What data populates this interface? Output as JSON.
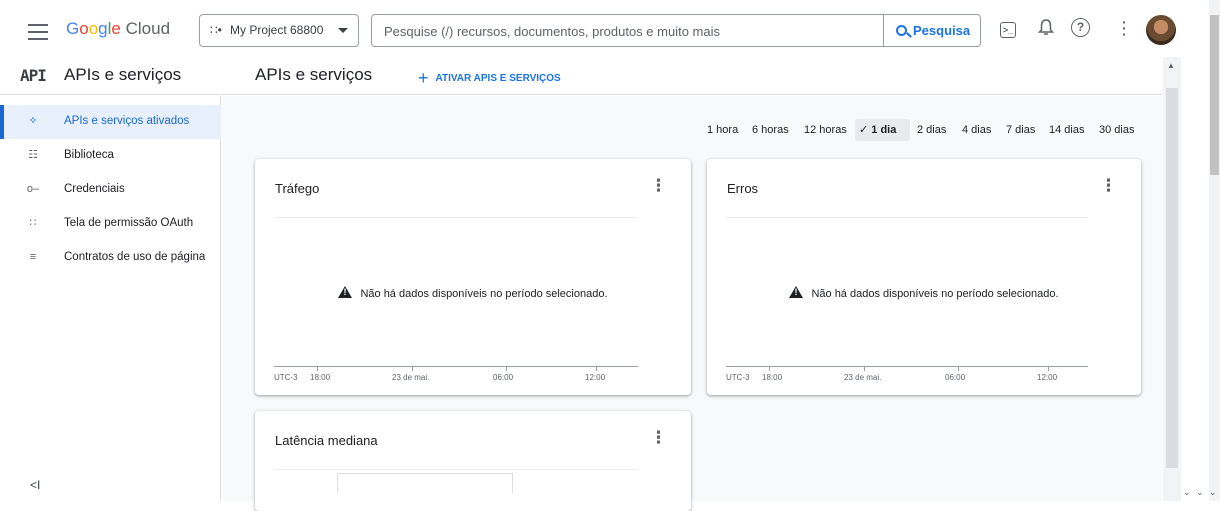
{
  "header": {
    "logo": {
      "g1": "G",
      "g2": "o",
      "g3": "o",
      "g4": "g",
      "g5": "l",
      "g6": "e",
      "cloud": "Cloud"
    },
    "project": "My Project 68800",
    "search_placeholder": "Pesquise (/) recursos, documentos, produtos e muito mais",
    "search_button": "Pesquisa"
  },
  "sidebar": {
    "product_icon_text": "API",
    "title": "APIs e serviços",
    "items": [
      {
        "label": "APIs e serviços ativados",
        "icon": "api-nodes-icon"
      },
      {
        "label": "Biblioteca",
        "icon": "library-icon"
      },
      {
        "label": "Credenciais",
        "icon": "key-icon"
      },
      {
        "label": "Tela de permissão OAuth",
        "icon": "oauth-consent-icon"
      },
      {
        "label": "Contratos de uso de página",
        "icon": "page-usage-icon"
      }
    ],
    "collapse_glyph": "<I"
  },
  "main": {
    "title": "APIs e serviços",
    "enable_button": "ATIVAR APIS E SERVIÇOS"
  },
  "time_ranges": [
    {
      "label": "1 hora",
      "selected": false
    },
    {
      "label": "6 horas",
      "selected": false
    },
    {
      "label": "12 horas",
      "selected": false
    },
    {
      "label": "1 dia",
      "selected": true
    },
    {
      "label": "2 dias",
      "selected": false
    },
    {
      "label": "4 dias",
      "selected": false
    },
    {
      "label": "7 dias",
      "selected": false
    },
    {
      "label": "14 dias",
      "selected": false
    },
    {
      "label": "30 dias",
      "selected": false
    }
  ],
  "cards": {
    "traffic": {
      "title": "Tráfego",
      "no_data": "Não há dados disponíveis no período selecionado."
    },
    "errors": {
      "title": "Erros",
      "no_data": "Não há dados disponíveis no período selecionado."
    },
    "latency": {
      "title": "Latência mediana"
    }
  },
  "axis": {
    "timezone": "UTC-3",
    "ticks": [
      "18:00",
      "23 de mai.",
      "06:00",
      "12:00"
    ]
  },
  "colors": {
    "accent": "#1a73e8",
    "active_bg": "#e8f0fe"
  }
}
